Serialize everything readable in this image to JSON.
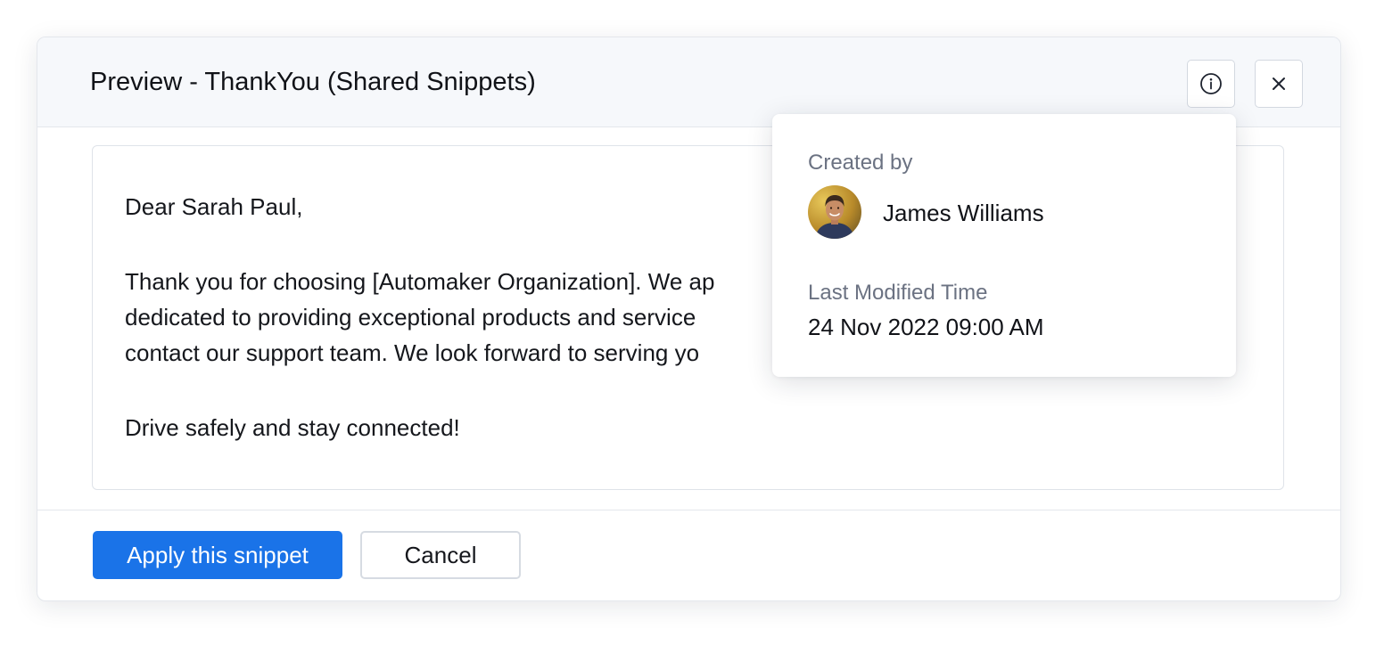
{
  "dialog": {
    "title": "Preview - ThankYou (Shared Snippets)",
    "info_icon": "info-icon",
    "close_icon": "close-icon"
  },
  "snippet": {
    "greeting": "Dear Sarah Paul,",
    "body_line_1": "Thank you for choosing [Automaker Organization]. We ap",
    "body_line_2": "dedicated to providing exceptional products and service",
    "body_line_3": "contact our support team. We look forward to serving yo",
    "closing": "Drive safely and stay connected!"
  },
  "footer": {
    "apply_label": "Apply this snippet",
    "cancel_label": "Cancel"
  },
  "info_popover": {
    "created_by_label": "Created by",
    "creator_name": "James Williams",
    "last_modified_label": "Last Modified Time",
    "last_modified_value": "24 Nov 2022 09:00 AM"
  },
  "colors": {
    "primary": "#1a73e8",
    "header_bg": "#f6f8fb",
    "muted_text": "#6b7282"
  }
}
